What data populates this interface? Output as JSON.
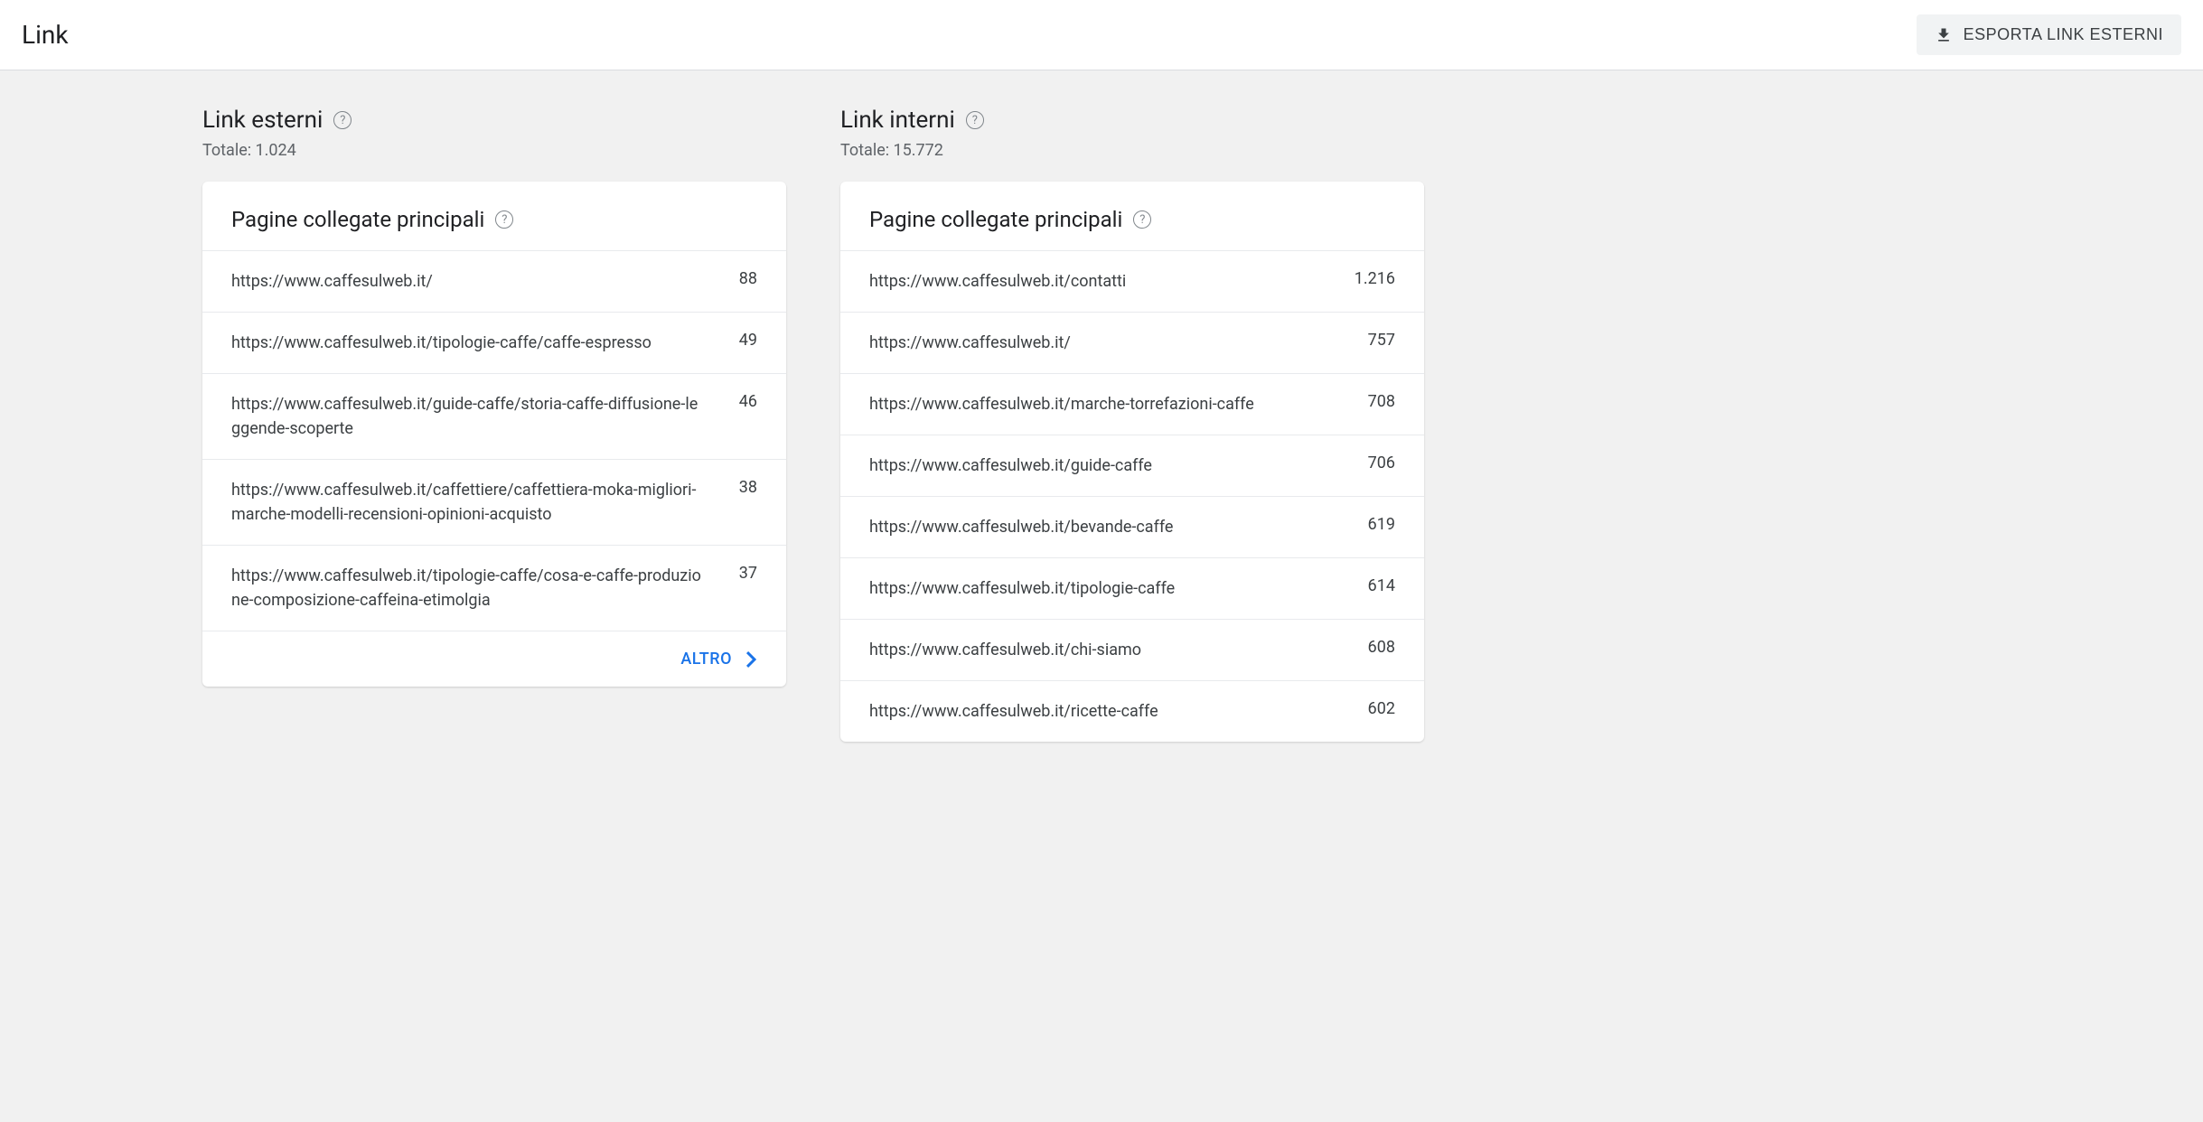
{
  "header": {
    "title": "Link",
    "export_button_label": "ESPORTA LINK ESTERNI"
  },
  "external": {
    "title": "Link esterni",
    "total_label": "Totale: 1.024",
    "card_title": "Pagine collegate principali",
    "more_label": "ALTRO",
    "links": [
      {
        "url": "https://www.caffesulweb.it/",
        "count": "88"
      },
      {
        "url": "https://www.caffesulweb.it/tipologie-caffe/caffe-espresso",
        "count": "49"
      },
      {
        "url": "https://www.caffesulweb.it/guide-caffe/storia-caffe-diffusione-leggende-scoperte",
        "count": "46"
      },
      {
        "url": "https://www.caffesulweb.it/caffettiere/caffettiera-moka-migliori-marche-modelli-recensioni-opinioni-acquisto",
        "count": "38"
      },
      {
        "url": "https://www.caffesulweb.it/tipologie-caffe/cosa-e-caffe-produzione-composizione-caffeina-etimolgia",
        "count": "37"
      }
    ]
  },
  "internal": {
    "title": "Link interni",
    "total_label": "Totale: 15.772",
    "card_title": "Pagine collegate principali",
    "links": [
      {
        "url": "https://www.caffesulweb.it/contatti",
        "count": "1.216"
      },
      {
        "url": "https://www.caffesulweb.it/",
        "count": "757"
      },
      {
        "url": "https://www.caffesulweb.it/marche-torrefazioni-caffe",
        "count": "708"
      },
      {
        "url": "https://www.caffesulweb.it/guide-caffe",
        "count": "706"
      },
      {
        "url": "https://www.caffesulweb.it/bevande-caffe",
        "count": "619"
      },
      {
        "url": "https://www.caffesulweb.it/tipologie-caffe",
        "count": "614"
      },
      {
        "url": "https://www.caffesulweb.it/chi-siamo",
        "count": "608"
      },
      {
        "url": "https://www.caffesulweb.it/ricette-caffe",
        "count": "602"
      }
    ]
  }
}
